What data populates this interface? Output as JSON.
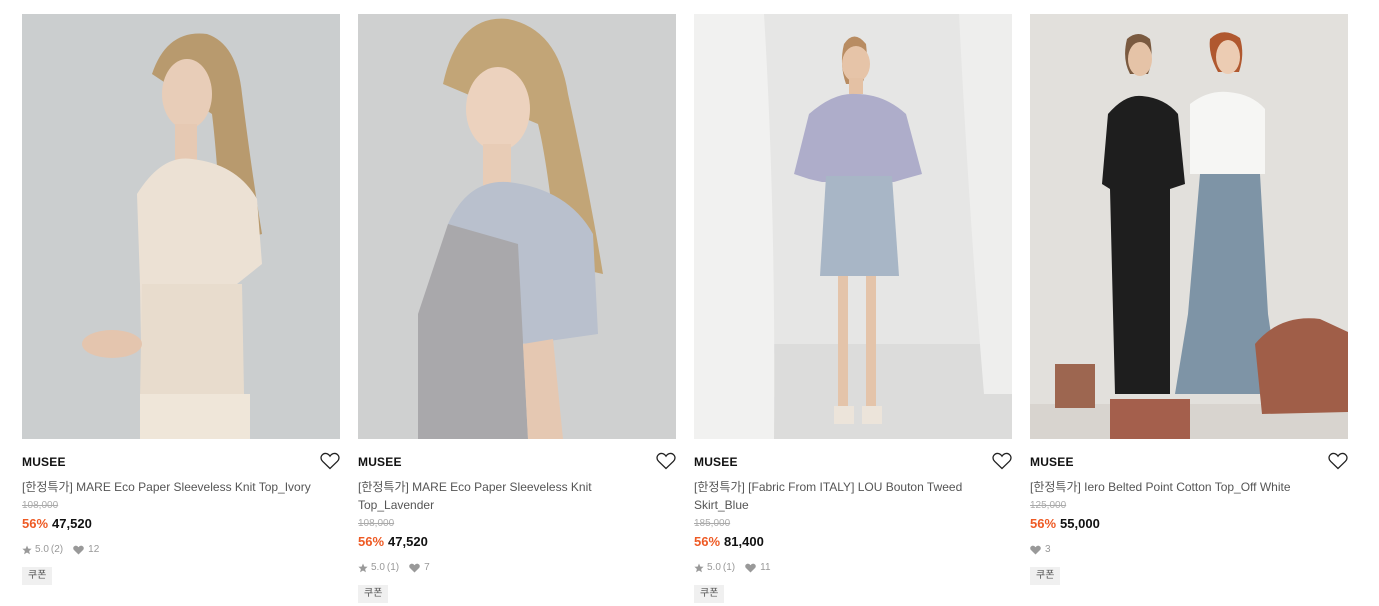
{
  "products": [
    {
      "brand": "MUSEE",
      "name": "[한정특가] MARE Eco Paper Sleeveless Knit Top_Ivory",
      "original_price": "108,000",
      "discount": "56%",
      "price": "47,520",
      "rating": "5.0",
      "review_count": "(2)",
      "likes": "12",
      "badge": "쿠폰",
      "image_desc": "model-ivory-knit-top"
    },
    {
      "brand": "MUSEE",
      "name": "[한정특가] MARE Eco Paper Sleeveless Knit Top_Lavender",
      "original_price": "108,000",
      "discount": "56%",
      "price": "47,520",
      "rating": "5.0",
      "review_count": "(1)",
      "likes": "7",
      "badge": "쿠폰",
      "image_desc": "model-lavender-knit-top"
    },
    {
      "brand": "MUSEE",
      "name": "[한정특가] [Fabric From ITALY] LOU Bouton Tweed Skirt_Blue",
      "original_price": "185,000",
      "discount": "56%",
      "price": "81,400",
      "rating": "5.0",
      "review_count": "(1)",
      "likes": "11",
      "badge": "쿠폰",
      "image_desc": "model-tweed-skirt-blue"
    },
    {
      "brand": "MUSEE",
      "name": "[한정특가] Iero Belted Point Cotton Top_Off White",
      "original_price": "125,000",
      "discount": "56%",
      "price": "55,000",
      "rating": "",
      "review_count": "",
      "likes": "3",
      "badge": "쿠폰",
      "image_desc": "two-models-cotton-tops"
    }
  ],
  "colors": {
    "discount": "#ee5a24",
    "price": "#111111",
    "original_price": "#aaaaaa",
    "meta": "#999999",
    "badge_bg": "#f0f0f0"
  },
  "icons": {
    "wishlist": "heart-outline-icon",
    "rating": "star-icon",
    "likes": "heart-filled-icon"
  }
}
